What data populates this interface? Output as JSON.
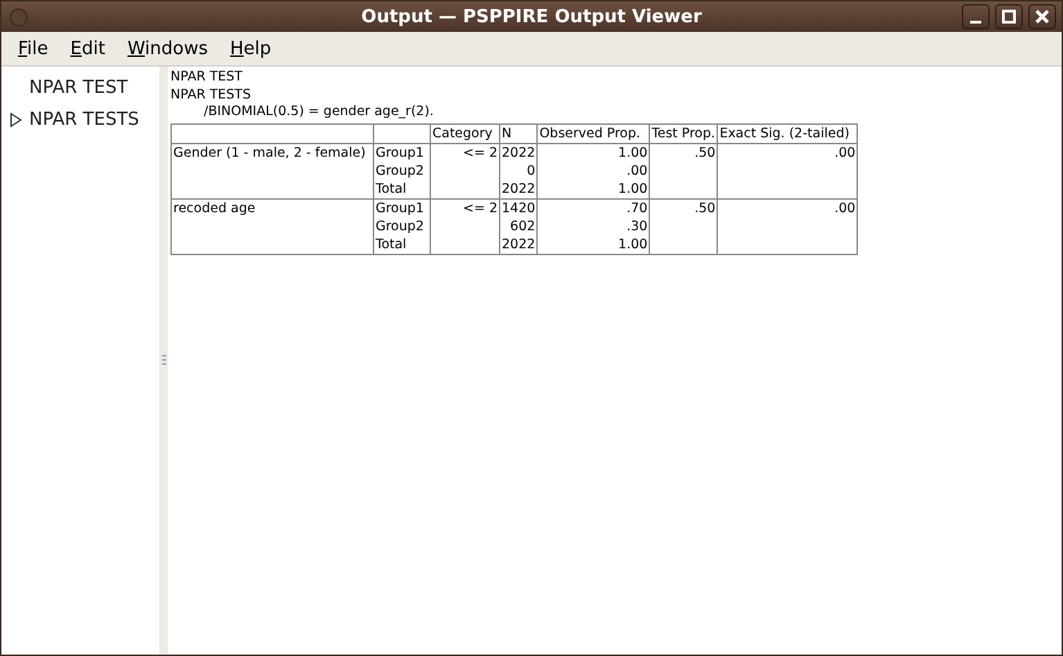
{
  "window": {
    "title": "Output — PSPPIRE Output Viewer"
  },
  "menu": [
    "File",
    "Edit",
    "Windows",
    "Help"
  ],
  "sidebar": {
    "items": [
      {
        "label": "NPAR TEST",
        "expandable": false
      },
      {
        "label": "NPAR TESTS",
        "expandable": true
      }
    ]
  },
  "output": {
    "lines": [
      {
        "text": "NPAR TEST",
        "indent": false
      },
      {
        "text": "NPAR TESTS",
        "indent": false
      },
      {
        "text": "/BINOMIAL(0.5) = gender age_r(2).",
        "indent": true
      }
    ],
    "table": {
      "columns": [
        "",
        "",
        "Category",
        "N",
        "Observed Prop.",
        "Test Prop.",
        "Exact Sig. (2-tailed)"
      ],
      "groups": [
        {
          "variable": "Gender (1 - male, 2 - female)",
          "rows": [
            {
              "group": "Group1",
              "category": "<= 2",
              "n": "2022",
              "observed": "1.00",
              "test": ".50",
              "exact": ".00"
            },
            {
              "group": "Group2",
              "n": "0",
              "observed": ".00"
            },
            {
              "group": "Total",
              "n": "2022",
              "observed": "1.00"
            }
          ]
        },
        {
          "variable": "recoded age",
          "rows": [
            {
              "group": "Group1",
              "category": "<= 2",
              "n": "1420",
              "observed": ".70",
              "test": ".50",
              "exact": ".00"
            },
            {
              "group": "Group2",
              "n": "602",
              "observed": ".30"
            },
            {
              "group": "Total",
              "n": "2022",
              "observed": "1.00"
            }
          ]
        }
      ]
    }
  }
}
